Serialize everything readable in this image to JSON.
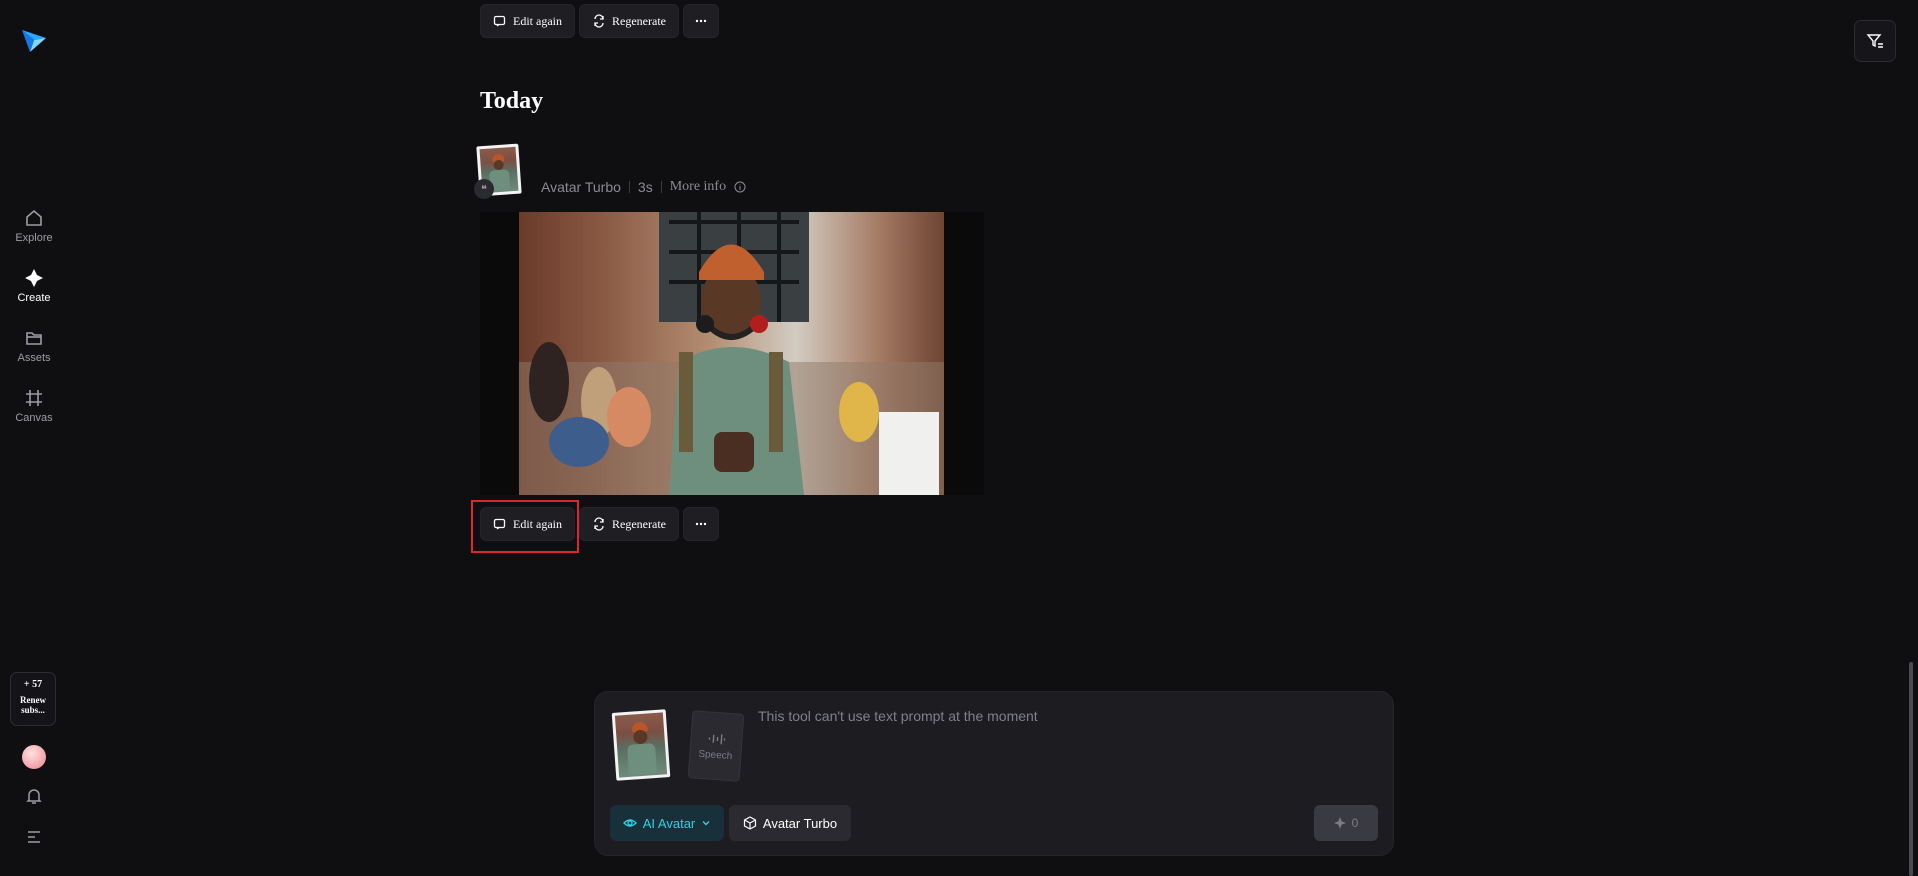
{
  "sidebar": {
    "items": [
      {
        "label": "Explore",
        "icon": "home-icon"
      },
      {
        "label": "Create",
        "icon": "sparkle-icon"
      },
      {
        "label": "Assets",
        "icon": "folder-icon"
      },
      {
        "label": "Canvas",
        "icon": "grid-icon"
      }
    ],
    "credits": {
      "value": "+ 57",
      "renew_label": "Renew subs..."
    }
  },
  "top_actions": {
    "edit_label": "Edit again",
    "regenerate_label": "Regenerate"
  },
  "section_title": "Today",
  "generation": {
    "model": "Avatar Turbo",
    "duration": "3s",
    "more_info": "More info"
  },
  "actions": {
    "edit_label": "Edit again",
    "regenerate_label": "Regenerate"
  },
  "prompt": {
    "placeholder": "This tool can't use text prompt at the moment",
    "speech_label": "Speech",
    "mode_label": "AI Avatar",
    "model_label": "Avatar Turbo",
    "generate_count": "0"
  },
  "colors": {
    "accent": "#33d0e0",
    "highlight": "#e0242b",
    "background": "#0f0f12"
  }
}
